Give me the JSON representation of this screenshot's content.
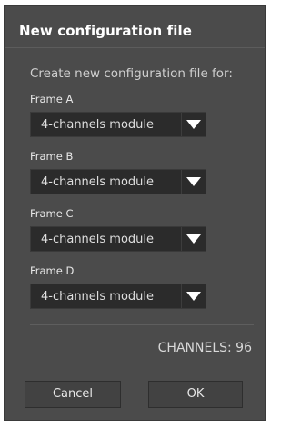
{
  "dialog": {
    "title": "New configuration file",
    "subtitle": "Create new configuration file for:",
    "frames": [
      {
        "label": "Frame A",
        "selected": "4-channels module"
      },
      {
        "label": "Frame B",
        "selected": "4-channels module"
      },
      {
        "label": "Frame C",
        "selected": "4-channels module"
      },
      {
        "label": "Frame D",
        "selected": "4-channels module"
      }
    ],
    "channels_text": "CHANNELS: 96",
    "buttons": {
      "cancel_label": "Cancel",
      "ok_label": "OK"
    }
  },
  "icons": {
    "dropdown_caret": "caret-down-icon"
  },
  "colors": {
    "dialog_background": "#4b4b4b",
    "select_background": "#2b2b2b",
    "button_background": "#424242"
  }
}
